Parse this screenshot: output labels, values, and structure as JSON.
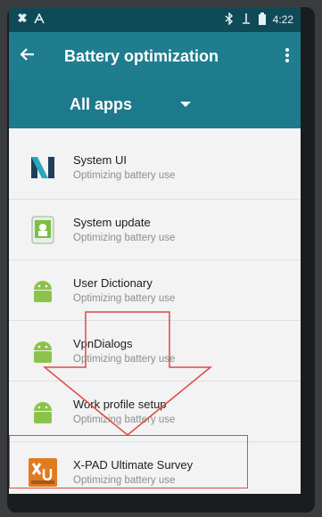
{
  "status_bar": {
    "time": "4:22",
    "left_icons": [
      "notification-icon",
      "text-icon"
    ],
    "right_icons": [
      "bluetooth-icon",
      "usb-icon",
      "battery-icon"
    ]
  },
  "app_bar": {
    "title": "Battery optimization",
    "back_icon": "arrow-back-icon",
    "overflow_icon": "more-vert-icon"
  },
  "filter": {
    "selected": "All apps"
  },
  "apps": [
    {
      "name": "System UI",
      "status": "Optimizing battery use",
      "icon": "system-ui-icon"
    },
    {
      "name": "System update",
      "status": "Optimizing battery use",
      "icon": "system-update-icon"
    },
    {
      "name": "User Dictionary",
      "status": "Optimizing battery use",
      "icon": "android-icon"
    },
    {
      "name": "VpnDialogs",
      "status": "Optimizing battery use",
      "icon": "android-icon"
    },
    {
      "name": "Work profile setup",
      "status": "Optimizing battery use",
      "icon": "android-icon"
    },
    {
      "name": "X-PAD Ultimate Survey",
      "status": "Optimizing battery use",
      "icon": "xpad-icon"
    }
  ],
  "colors": {
    "toolbar": "#1f7d8f",
    "status_bar": "#0f4a57",
    "list_bg": "#f2f3f2",
    "annotation": "#e04848"
  }
}
